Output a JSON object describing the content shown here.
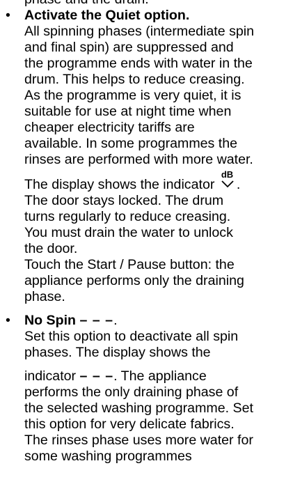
{
  "top_cut_line": "phase and the drain.",
  "quiet": {
    "bullet": "•",
    "title": "Activate the Quiet option.",
    "lines": [
      "All spinning phases (intermediate spin",
      "and final spin) are suppressed and",
      "the programme ends with water in the",
      "drum. This helps to reduce creasing.",
      "As the programme is very quiet, it is",
      "suitable for use at night time when",
      "cheaper electricity tariffs are",
      "available. In some programmes the",
      "rinses are performed with more water."
    ],
    "display_prefix": "The display shows the indicator",
    "indicator_icon": "db-quiet-icon",
    "indicator_text": "dB",
    "display_suffix": ".",
    "lines2": [
      "The door stays locked. The drum",
      "turns regularly to reduce creasing.",
      "You must drain the water to unlock",
      "the door.",
      "Touch the Start / Pause button: the",
      "appliance performs only the draining",
      "phase."
    ]
  },
  "nospin": {
    "bullet": "•",
    "title": "No Spin",
    "title_indicator": "– – –",
    "title_suffix": ".",
    "lines": [
      "Set this option to deactivate all spin",
      "phases. The display shows the"
    ],
    "indicator_prefix": "indicator",
    "indicator": "– – –",
    "indicator_suffix": ". The appliance",
    "lines2": [
      "performs the only draining phase of",
      "the selected washing programme. Set",
      "this option for very delicate fabrics.",
      "The rinses phase uses more water for",
      "some washing programmes"
    ]
  }
}
